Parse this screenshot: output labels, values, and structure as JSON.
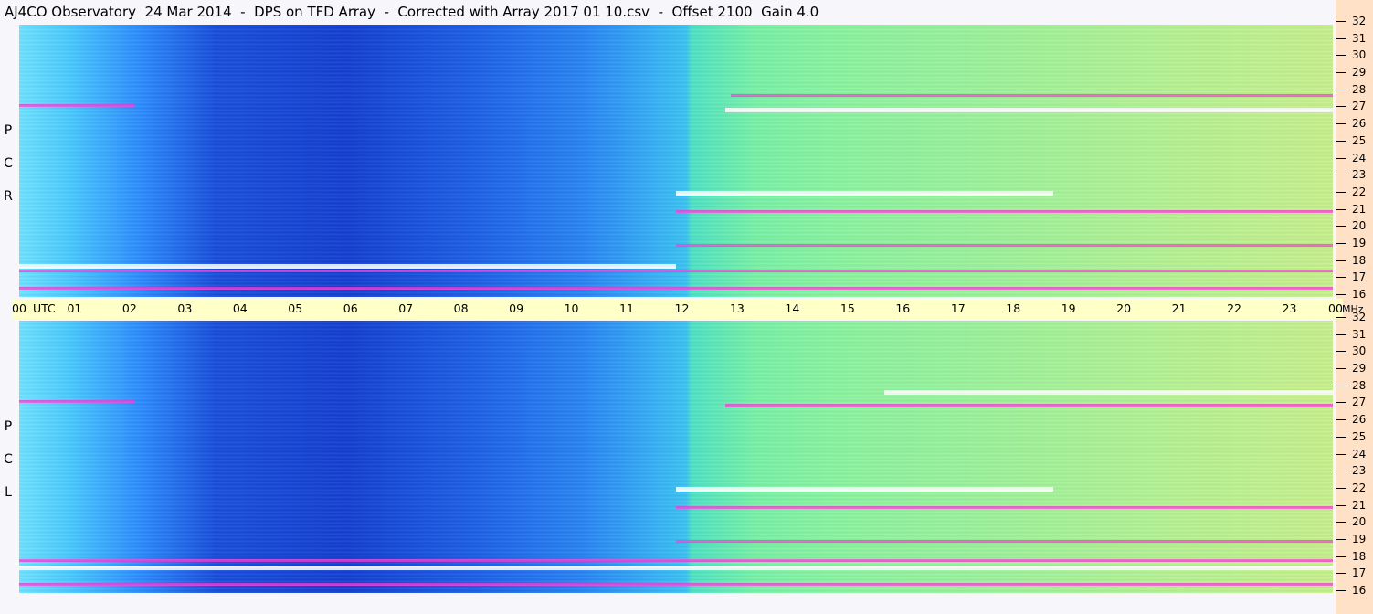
{
  "title": "AJ4CO Observatory  24 Mar 2014  -  DPS on TFD Array  -  Corrected with Array 2017 01 10.csv  -  Offset 2100  Gain 4.0",
  "panels": [
    {
      "id": "rcp",
      "letters": [
        "P",
        "C",
        "R"
      ]
    },
    {
      "id": "lcp",
      "letters": [
        "P",
        "C",
        "L"
      ]
    }
  ],
  "time_axis": {
    "labels": [
      "00",
      "UTC",
      "01",
      "02",
      "03",
      "04",
      "05",
      "06",
      "07",
      "08",
      "09",
      "10",
      "11",
      "12",
      "13",
      "14",
      "15",
      "16",
      "17",
      "18",
      "19",
      "20",
      "21",
      "22",
      "23",
      "00"
    ]
  },
  "freq_axis": {
    "labels": [
      "32",
      "31",
      "30",
      "29",
      "28",
      "27",
      "26",
      "25",
      "24",
      "23",
      "22",
      "21",
      "20",
      "19",
      "18",
      "17",
      "16"
    ],
    "unit": "MHz"
  },
  "colors": {
    "low": "#1541d2",
    "mid": "#3cc4f2",
    "high": "#9ff29a",
    "hot": "#ff3ad8",
    "sat": "#ffffff",
    "axis_bg": "#ffffc8",
    "freq_bg": "#ffe1c8"
  },
  "chart_data": [
    {
      "type": "heatmap",
      "title": "AJ4CO Observatory  24 Mar 2014  -  DPS on TFD Array  -  Corrected with Array 2017 01 10.csv  -  Offset 2100  Gain 4.0",
      "ylabel": "R C P",
      "xlabel": "UTC",
      "xlim": [
        0,
        24
      ],
      "ylim": [
        16,
        32
      ],
      "x_ticks": [
        "00",
        "01",
        "02",
        "03",
        "04",
        "05",
        "06",
        "07",
        "08",
        "09",
        "10",
        "11",
        "12",
        "13",
        "14",
        "15",
        "16",
        "17",
        "18",
        "19",
        "20",
        "21",
        "22",
        "23",
        "00"
      ],
      "y_ticks": [
        "16",
        "17",
        "18",
        "19",
        "20",
        "21",
        "22",
        "23",
        "24",
        "25",
        "26",
        "27",
        "28",
        "29",
        "30",
        "31",
        "32"
      ],
      "y_unit": "MHz",
      "hot_bands": [
        {
          "t0": 12.9,
          "t1": 24,
          "f": 27.0,
          "level": "sat"
        },
        {
          "t0": 13.0,
          "t1": 24,
          "f": 27.8,
          "level": "hot"
        },
        {
          "t0": 12.0,
          "t1": 18.9,
          "f": 22.1,
          "level": "sat"
        },
        {
          "t0": 0,
          "t1": 24,
          "f": 17.5,
          "level": "hot"
        },
        {
          "t0": 0,
          "t1": 12,
          "f": 17.8,
          "level": "sat"
        },
        {
          "t0": 0,
          "t1": 2.1,
          "f": 27.2,
          "level": "hot"
        },
        {
          "t0": 12,
          "t1": 24,
          "f": 19.0,
          "level": "hot"
        },
        {
          "t0": 12,
          "t1": 24,
          "f": 21.0,
          "level": "hot"
        },
        {
          "t0": 0,
          "t1": 24,
          "f": 16.5,
          "level": "hot"
        }
      ]
    },
    {
      "type": "heatmap",
      "title": "AJ4CO Observatory  24 Mar 2014  -  DPS on TFD Array  -  Corrected with Array 2017 01 10.csv  -  Offset 2100  Gain 4.0",
      "ylabel": "L C P",
      "xlabel": "UTC",
      "xlim": [
        0,
        24
      ],
      "ylim": [
        16,
        32
      ],
      "x_ticks": [
        "00",
        "01",
        "02",
        "03",
        "04",
        "05",
        "06",
        "07",
        "08",
        "09",
        "10",
        "11",
        "12",
        "13",
        "14",
        "15",
        "16",
        "17",
        "18",
        "19",
        "20",
        "21",
        "22",
        "23",
        "00"
      ],
      "y_ticks": [
        "16",
        "17",
        "18",
        "19",
        "20",
        "21",
        "22",
        "23",
        "24",
        "25",
        "26",
        "27",
        "28",
        "29",
        "30",
        "31",
        "32"
      ],
      "y_unit": "MHz",
      "hot_bands": [
        {
          "t0": 12.9,
          "t1": 24,
          "f": 27.0,
          "level": "hot"
        },
        {
          "t0": 15.8,
          "t1": 24,
          "f": 27.8,
          "level": "sat"
        },
        {
          "t0": 12.0,
          "t1": 18.9,
          "f": 22.1,
          "level": "sat"
        },
        {
          "t0": 0,
          "t1": 24,
          "f": 17.5,
          "level": "sat"
        },
        {
          "t0": 0,
          "t1": 24,
          "f": 17.9,
          "level": "hot"
        },
        {
          "t0": 0,
          "t1": 2.1,
          "f": 27.2,
          "level": "hot"
        },
        {
          "t0": 12,
          "t1": 24,
          "f": 19.0,
          "level": "hot"
        },
        {
          "t0": 12,
          "t1": 24,
          "f": 21.0,
          "level": "hot"
        },
        {
          "t0": 0,
          "t1": 24,
          "f": 16.5,
          "level": "hot"
        }
      ]
    }
  ]
}
